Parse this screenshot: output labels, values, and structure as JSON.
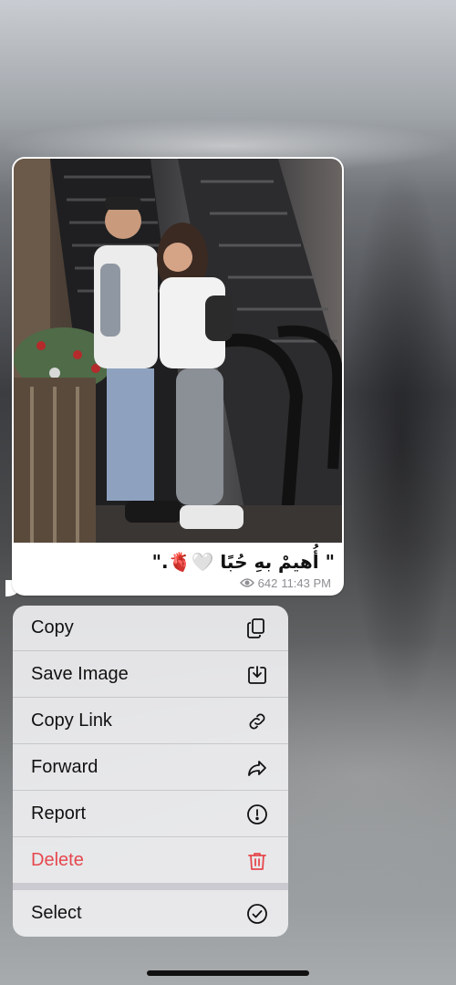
{
  "message": {
    "caption": "\" أُهيمْ بهِ حُبًا 🤍🫀.\"",
    "views": "642",
    "time": "11:43 PM"
  },
  "photo": {
    "icon": "photo-couple-escalator"
  },
  "menu": {
    "items": [
      {
        "label": "Copy",
        "icon": "copy-icon"
      },
      {
        "label": "Save Image",
        "icon": "download-icon"
      },
      {
        "label": "Copy Link",
        "icon": "link-icon"
      },
      {
        "label": "Forward",
        "icon": "forward-icon"
      },
      {
        "label": "Report",
        "icon": "exclamation-icon"
      },
      {
        "label": "Delete",
        "icon": "trash-icon",
        "color": "#e5484d"
      },
      {
        "label": "Select",
        "icon": "checkmark-circle-icon"
      }
    ]
  }
}
